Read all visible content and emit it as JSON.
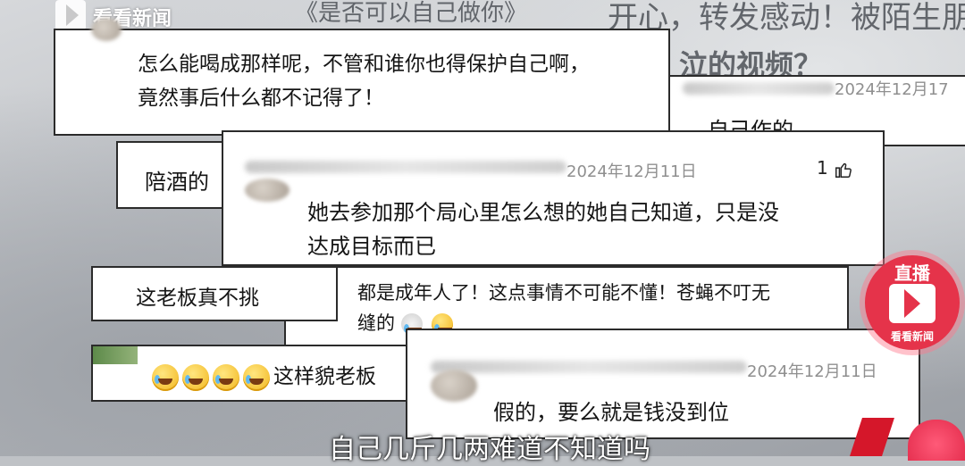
{
  "watermark": {
    "brand": "看看新闻"
  },
  "background_text": [
    "《是否可以自己做你》",
    "开心，转发感动！被陌生朋",
    "泣的视频？"
  ],
  "comments": [
    {
      "text_lines": [
        "怎么能喝成那样呢，不管和谁你也得保护自己啊，",
        "竟然事后什么都不记得了！"
      ]
    },
    {
      "date": "2024年12月17",
      "text_lines": [
        "自己作的"
      ]
    },
    {
      "text_lines": [
        "陪酒的"
      ]
    },
    {
      "date": "2024年12月11日",
      "likes": "1",
      "text_lines": [
        "她去参加那个局心里怎么想的她自己知道，只是没",
        "达成目标而已"
      ]
    },
    {
      "text_lines": [
        "这老板真不挑"
      ]
    },
    {
      "text_lines": [
        "都是成年人了！这点事情不可能不懂！苍蝇不叮无",
        "缝的"
      ]
    },
    {
      "text_lines": [
        "这样貌老板"
      ]
    },
    {
      "date": "2024年12月11日",
      "text_lines": [
        "假的，要么就是钱没到位"
      ]
    }
  ],
  "live_badge": {
    "label": "直播",
    "brand": "看看新闻"
  },
  "subtitle": "自己几斤几两难道不知道吗",
  "icons": {
    "like": "thumbs-up-icon",
    "emoji": "laugh-cry-emoji-icon",
    "logo": "kankan-logo-icon"
  },
  "colors": {
    "badge": "#e5334a",
    "card_border": "#2b2b2b",
    "date": "#8f8f8f"
  }
}
